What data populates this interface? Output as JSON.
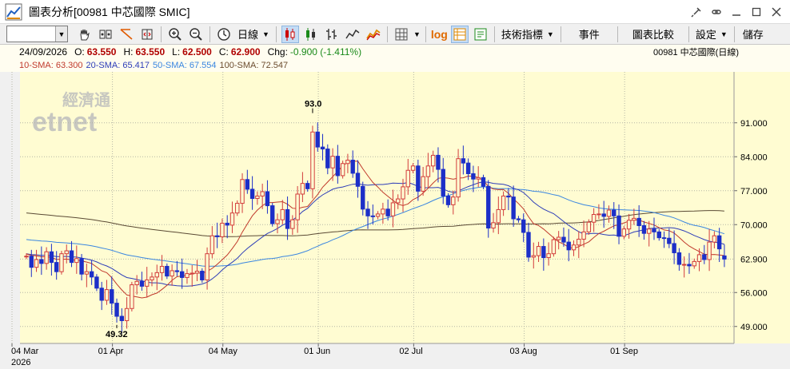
{
  "window": {
    "title": "圖表分析[00981 中芯國際 SMIC]"
  },
  "toolbar": {
    "period_label": "日線",
    "indicators_label": "技術指標",
    "events_label": "事件",
    "compare_label": "圖表比較",
    "settings_label": "設定",
    "save_label": "儲存",
    "log_label": "log"
  },
  "info": {
    "date": "24/09/2026",
    "open_label": "O:",
    "open": "63.550",
    "high_label": "H:",
    "high": "63.550",
    "low_label": "L:",
    "low": "62.500",
    "close_label": "C:",
    "close": "62.900",
    "chg_label": "Chg:",
    "chg": "-0.900 (-1.411%)",
    "stock_name": "00981  中芯國際(日線)"
  },
  "sma": {
    "sma10": "10-SMA: 63.300",
    "sma20": "20-SMA: 65.417",
    "sma50": "50-SMA: 67.554",
    "sma100": "100-SMA: 72.547"
  },
  "watermark": {
    "line1": "經濟通",
    "line2": "etnet"
  },
  "colors": {
    "up": "#d23c3c",
    "down": "#1c2fc8",
    "sma10": "#c0392b",
    "sma20": "#2d3db8",
    "sma50": "#3a86e0",
    "sma100": "#5a4a34",
    "background": "#fffcd2"
  },
  "chart_data": {
    "type": "candlestick",
    "ylim": [
      45.5,
      101.5
    ],
    "y_ticks": [
      "91.000",
      "84.000",
      "77.000",
      "70.000",
      "56.000",
      "49.000"
    ],
    "y_tick_values": [
      91,
      84,
      77,
      70,
      56,
      49
    ],
    "last_price_label": "62.900",
    "last_price": 62.9,
    "x_labels": [
      "04 Mar",
      "01 Apr",
      "04 May",
      "01 Jun",
      "02 Jul",
      "03 Aug",
      "01 Sep"
    ],
    "x_label_indices": [
      0,
      20,
      42,
      61,
      80,
      102,
      122
    ],
    "year_label": "2026",
    "high_annotation": "93.0",
    "high_value": 93.0,
    "high_index": 57,
    "low_annotation": "49.32",
    "low_value": 49.32,
    "low_index": 18,
    "closes": [
      63.5,
      61.2,
      62.8,
      62.0,
      64.4,
      62.2,
      60.3,
      64.0,
      64.6,
      62.2,
      63.0,
      59.8,
      60.3,
      59.2,
      56.9,
      54.4,
      56.6,
      53.8,
      51.1,
      50.2,
      52.7,
      57.6,
      58.3,
      57.3,
      58.6,
      59.2,
      60.1,
      61.4,
      59.4,
      60.5,
      60.3,
      59.1,
      59.9,
      60.0,
      60.4,
      58.6,
      64.0,
      67.7,
      67.5,
      70.3,
      69.9,
      72.4,
      74.4,
      79.3,
      77.3,
      75.4,
      75.9,
      76.8,
      73.9,
      70.2,
      71.0,
      73.1,
      69.2,
      71.0,
      76.3,
      78.5,
      77.4,
      89.1,
      86.0,
      85.6,
      81.7,
      84.1,
      80.1,
      82.6,
      83.3,
      80.6,
      77.9,
      73.2,
      71.8,
      71.7,
      72.2,
      73.2,
      71.8,
      74.5,
      75.3,
      77.8,
      81.2,
      82.1,
      76.9,
      79.9,
      82.1,
      84.3,
      81.4,
      75.9,
      74.1,
      75.7,
      83.6,
      82.7,
      80.5,
      79.4,
      79.7,
      77.9,
      69.3,
      70.4,
      73.1,
      75.9,
      75.7,
      71.2,
      71.0,
      68.4,
      63.3,
      63.6,
      65.5,
      63.2,
      64.0,
      66.9,
      67.4,
      66.4,
      64.8,
      65.8,
      67.0,
      68.5,
      70.5,
      72.1,
      72.2,
      71.7,
      73.0,
      71.8,
      67.6,
      69.1,
      70.9,
      71.3,
      69.8,
      68.2,
      69.1,
      68.5,
      67.3,
      67.2,
      66.1,
      64.2,
      61.8,
      61.8,
      61.5,
      62.4,
      63.8,
      62.8,
      66.4,
      67.7,
      65.0,
      62.9
    ],
    "opens": [
      63.5,
      63.5,
      61.2,
      62.8,
      62.0,
      64.4,
      62.2,
      60.3,
      64.0,
      64.6,
      62.2,
      63.0,
      59.8,
      60.3,
      59.2,
      56.9,
      54.4,
      56.6,
      53.8,
      51.1,
      50.2,
      52.7,
      57.6,
      58.3,
      57.3,
      58.6,
      59.2,
      60.1,
      61.4,
      59.4,
      60.5,
      60.3,
      59.1,
      59.9,
      60.0,
      60.4,
      58.6,
      64.0,
      67.7,
      67.5,
      70.3,
      69.9,
      72.4,
      74.4,
      79.3,
      77.3,
      75.4,
      75.9,
      76.8,
      73.9,
      70.2,
      71.0,
      73.1,
      69.2,
      71.0,
      76.3,
      78.5,
      77.4,
      89.1,
      86.0,
      85.6,
      81.7,
      84.1,
      80.1,
      82.6,
      83.3,
      80.6,
      77.9,
      73.2,
      71.8,
      71.7,
      72.2,
      73.2,
      71.8,
      74.5,
      75.3,
      77.8,
      81.2,
      82.1,
      76.9,
      79.9,
      82.1,
      84.3,
      81.4,
      75.9,
      74.1,
      75.7,
      83.6,
      82.7,
      80.5,
      79.4,
      79.7,
      77.9,
      69.3,
      70.4,
      73.1,
      75.9,
      75.7,
      71.2,
      71.0,
      68.4,
      63.3,
      63.6,
      65.5,
      63.2,
      64.0,
      66.9,
      67.4,
      66.4,
      64.8,
      65.8,
      67.0,
      68.5,
      70.5,
      72.1,
      72.2,
      71.7,
      73.0,
      71.8,
      67.6,
      69.1,
      70.9,
      71.3,
      69.8,
      68.2,
      69.1,
      68.5,
      67.3,
      67.2,
      66.1,
      64.2,
      61.8,
      61.8,
      61.5,
      62.4,
      63.8,
      62.8,
      66.4,
      67.7,
      63.55
    ]
  }
}
